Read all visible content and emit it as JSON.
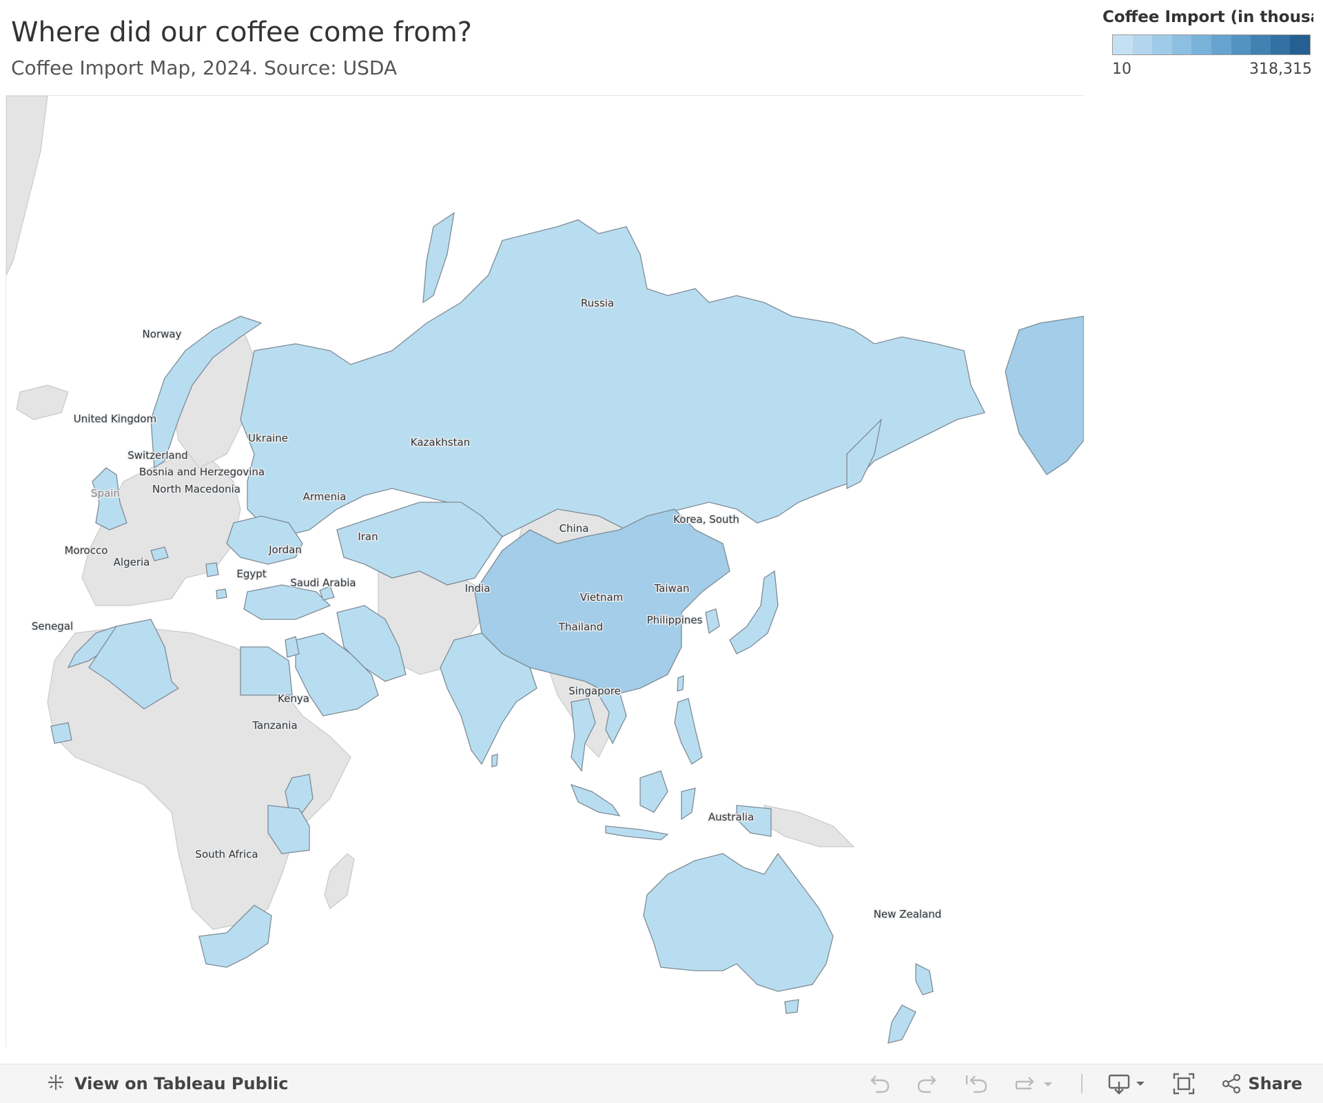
{
  "header": {
    "title": "Where did our coffee come from?",
    "subtitle": "Coffee Import Map, 2024. Source: USDA"
  },
  "legend": {
    "title": "Coffee Import (in thousa...",
    "min_label": "10",
    "max_label": "318,315",
    "colors": [
      "#c5e0f2",
      "#b3d6ee",
      "#9fcbe8",
      "#8cbfe1",
      "#79b2d9",
      "#66a3cf",
      "#5393c2",
      "#4282b3",
      "#3371a3",
      "#265f91"
    ]
  },
  "colors": {
    "low": "#b9ddf0",
    "mid": "#a3cde8",
    "no_data": "#e4e4e4"
  },
  "map": {
    "labels": [
      "Russia",
      "Norway",
      "United Kingdom",
      "Ukraine",
      "Switzerland",
      "Bosnia and Herzegovina",
      "North Macedonia",
      "Spain",
      "Kazakhstan",
      "Armenia",
      "China",
      "Korea, South",
      "Iran",
      "Jordan",
      "Morocco",
      "Algeria",
      "Egypt",
      "Saudi Arabia",
      "India",
      "Taiwan",
      "Vietnam",
      "Thailand",
      "Philippines",
      "Senegal",
      "Singapore",
      "Kenya",
      "Tanzania",
      "Australia",
      "South Africa",
      "New Zealand"
    ]
  },
  "toolbar": {
    "view_label": "View on Tableau Public",
    "share_label": "Share"
  }
}
